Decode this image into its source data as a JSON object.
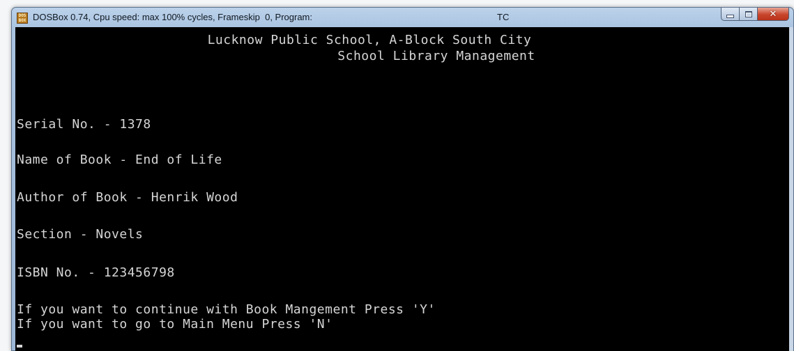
{
  "window": {
    "title": "DOSBox 0.74, Cpu speed: max 100% cycles, Frameskip  0, Program:",
    "program": "TC",
    "icon": "DOS BOX",
    "controls": {
      "minimize": "minimize-icon",
      "maximize": "maximize-icon",
      "close": "close-icon"
    }
  },
  "console": {
    "header_line1": "Lucknow Public School, A-Block South City",
    "header_line2": "School Library Management",
    "serial": "Serial No. - 1378",
    "book_name": "Name of Book - End of Life",
    "author": "Author of Book - Henrik Wood",
    "section": "Section - Novels",
    "isbn": "ISBN No. - 123456798",
    "prompt_continue": "If you want to continue with Book Mangement Press 'Y'",
    "prompt_menu": "If you want to go to Main Menu Press 'N'"
  },
  "colors": {
    "console_bg": "#000000",
    "console_text": "#d6d6d6",
    "close_button": "#c8452b"
  }
}
